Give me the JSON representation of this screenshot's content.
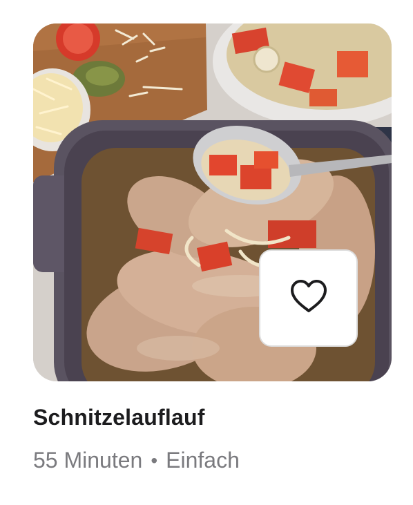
{
  "recipe": {
    "title": "Schnitzelauflauf",
    "duration": "55 Minuten",
    "separator": "•",
    "difficulty": "Einfach"
  },
  "favorite_button": {
    "icon": "heart-outline-icon",
    "color": "#1c1c1e",
    "background": "#ffffff"
  },
  "colors": {
    "title": "#1c1c1e",
    "meta": "#7a7a7e"
  }
}
